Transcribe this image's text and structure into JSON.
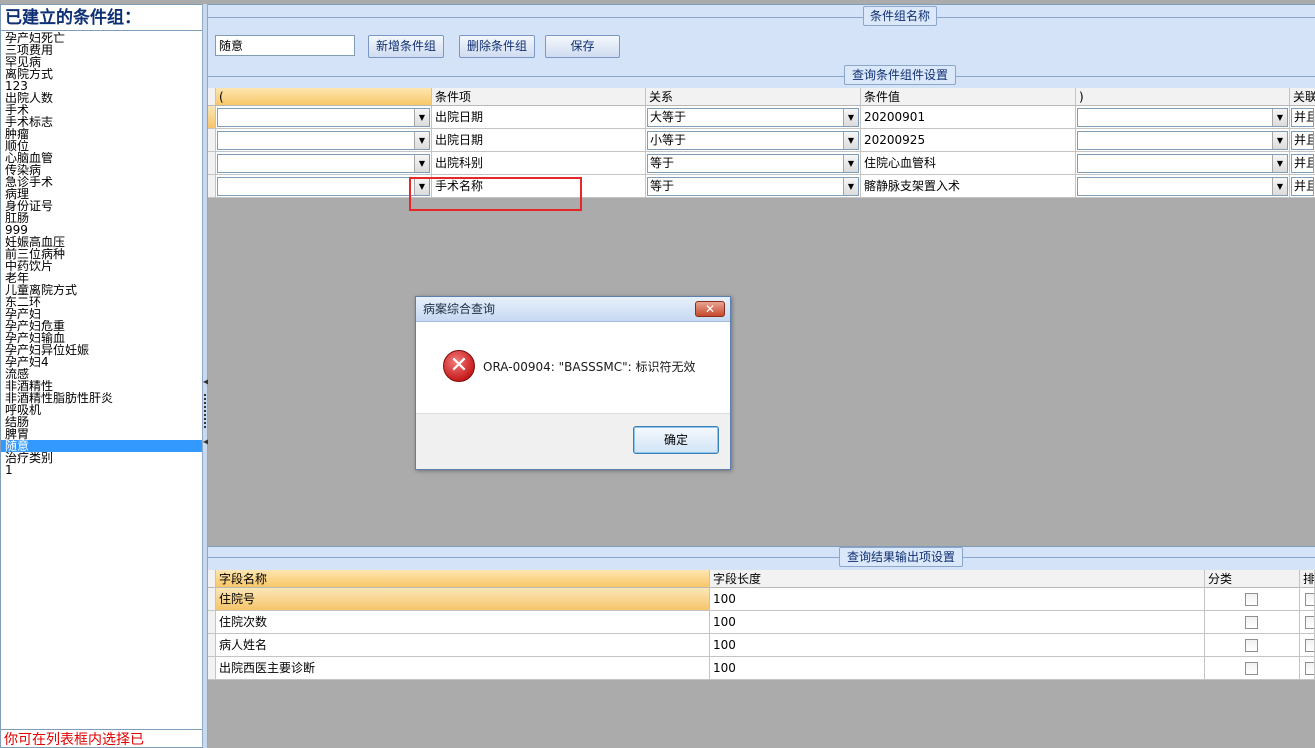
{
  "left_panel": {
    "title": "已建立的条件组：",
    "groups": [
      "孕产妇死亡",
      "三项费用",
      "罕见病",
      "离院方式",
      "123",
      "出院人数",
      "手术",
      "手术标志",
      "肿瘤",
      "顺位",
      "心脑血管",
      "传染病",
      "急诊手术",
      "病理",
      "身份证号",
      "肛肠",
      "999",
      "妊娠高血压",
      "前三位病种",
      "中药饮片",
      "老年",
      "儿童离院方式",
      "东二环",
      "孕产妇",
      "孕产妇危重",
      "孕产妇输血",
      "孕产妇异位妊娠",
      "孕产妇4",
      "流感",
      "非酒精性",
      "非酒精性脂肪性肝炎",
      "呼吸机",
      "结肠",
      "脾胃",
      "随意",
      "治疗类别",
      "1"
    ],
    "selected": "随意",
    "hint": "你可在列表框内选择已"
  },
  "group_section": {
    "legend": "条件组名称",
    "name_value": "随意",
    "add_label": "新增条件组",
    "delete_label": "删除条件组",
    "save_label": "保存"
  },
  "condition_section": {
    "legend": "查询条件组件设置",
    "columns": [
      "(",
      "条件项",
      "关系",
      "条件值",
      ")",
      "关联"
    ],
    "rows": [
      {
        "open": "",
        "item": "出院日期",
        "relation": "大等于",
        "value": "20200901",
        "close": "",
        "link": "并且"
      },
      {
        "open": "",
        "item": "出院日期",
        "relation": "小等于",
        "value": "20200925",
        "close": "",
        "link": "并且"
      },
      {
        "open": "",
        "item": "出院科别",
        "relation": "等于",
        "value": "住院心血管科",
        "close": "",
        "link": "并且"
      },
      {
        "open": "",
        "item": "手术名称",
        "relation": "等于",
        "value": "髂静脉支架置入术",
        "close": "",
        "link": "并且"
      }
    ]
  },
  "result_section": {
    "legend": "查询结果输出项设置",
    "columns": [
      "字段名称",
      "字段长度",
      "分类",
      "排"
    ],
    "rows": [
      {
        "name": "住院号",
        "length": "100",
        "category": false
      },
      {
        "name": "住院次数",
        "length": "100",
        "category": false
      },
      {
        "name": "病人姓名",
        "length": "100",
        "category": false
      },
      {
        "name": "出院西医主要诊断",
        "length": "100",
        "category": false
      }
    ]
  },
  "dialog": {
    "title": "病案综合查询",
    "close_glyph": "✕",
    "icon_glyph": "✕",
    "message": "ORA-00904: \"BASSSMC\": 标识符无效",
    "ok_label": "确定"
  },
  "colors": {
    "selection": "#3399ff",
    "highlight": "#e8262a",
    "legend_text": "#0f2f73",
    "hint_text": "#e00000"
  }
}
